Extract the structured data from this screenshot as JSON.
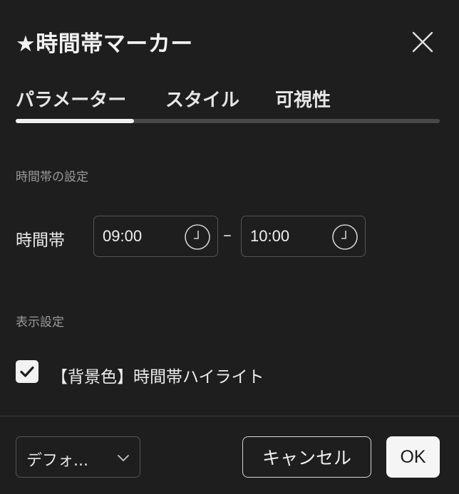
{
  "dialog": {
    "title": "★時間帯マーカー",
    "close_icon": "close-icon"
  },
  "tabs": [
    {
      "label": "パラメーター",
      "active": true
    },
    {
      "label": "スタイル",
      "active": false
    },
    {
      "label": "可視性",
      "active": false
    }
  ],
  "time_section": {
    "heading": "時間帯の設定",
    "field_label": "時間帯",
    "start": "09:00",
    "separator": "–",
    "end": "10:00",
    "picker_icon": "clock-icon"
  },
  "display_section": {
    "heading": "表示設定",
    "highlight": {
      "label": "【背景色】時間帯ハイライト",
      "checked": true
    }
  },
  "footer": {
    "preset": "デフォ...",
    "preset_icon": "chevron-down-icon",
    "cancel_label": "キャンセル",
    "ok_label": "OK"
  },
  "colors": {
    "background": "#1e1e1e",
    "text": "#e8e8e8",
    "muted": "#9a9a9a",
    "border": "#555555",
    "accent": "#f5f5f5"
  }
}
